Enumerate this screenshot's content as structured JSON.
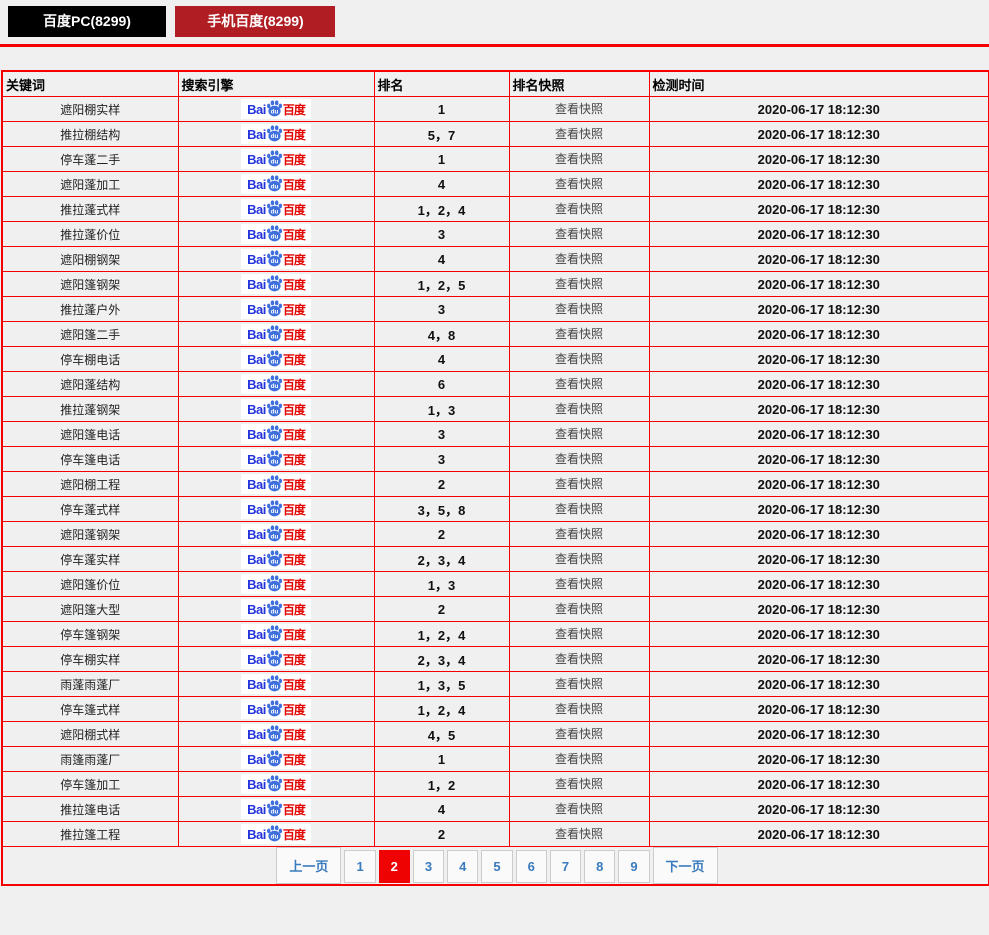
{
  "tabs": [
    {
      "id": "baidu-pc",
      "label": "百度PC(8299)"
    },
    {
      "id": "mobile-baidu",
      "label": "手机百度(8299)"
    }
  ],
  "table": {
    "headers": [
      "关键词",
      "搜索引擎",
      "排名",
      "排名快照",
      "检测时间"
    ],
    "snapshot_label": "查看快照",
    "search_engine_logo": {
      "bai": "Bai",
      "du": "du",
      "cn": "百度"
    },
    "rows": [
      {
        "keyword": "遮阳棚实样",
        "rank": "1",
        "time": "2020-06-17 18:12:30"
      },
      {
        "keyword": "推拉棚结构",
        "rank": "5，7",
        "time": "2020-06-17 18:12:30"
      },
      {
        "keyword": "停车蓬二手",
        "rank": "1",
        "time": "2020-06-17 18:12:30"
      },
      {
        "keyword": "遮阳蓬加工",
        "rank": "4",
        "time": "2020-06-17 18:12:30"
      },
      {
        "keyword": "推拉蓬式样",
        "rank": "1，2，4",
        "time": "2020-06-17 18:12:30"
      },
      {
        "keyword": "推拉蓬价位",
        "rank": "3",
        "time": "2020-06-17 18:12:30"
      },
      {
        "keyword": "遮阳棚钢架",
        "rank": "4",
        "time": "2020-06-17 18:12:30"
      },
      {
        "keyword": "遮阳篷钢架",
        "rank": "1，2，5",
        "time": "2020-06-17 18:12:30"
      },
      {
        "keyword": "推拉蓬户外",
        "rank": "3",
        "time": "2020-06-17 18:12:30"
      },
      {
        "keyword": "遮阳篷二手",
        "rank": "4，8",
        "time": "2020-06-17 18:12:30"
      },
      {
        "keyword": "停车棚电话",
        "rank": "4",
        "time": "2020-06-17 18:12:30"
      },
      {
        "keyword": "遮阳蓬结构",
        "rank": "6",
        "time": "2020-06-17 18:12:30"
      },
      {
        "keyword": "推拉蓬钢架",
        "rank": "1，3",
        "time": "2020-06-17 18:12:30"
      },
      {
        "keyword": "遮阳篷电话",
        "rank": "3",
        "time": "2020-06-17 18:12:30"
      },
      {
        "keyword": "停车篷电话",
        "rank": "3",
        "time": "2020-06-17 18:12:30"
      },
      {
        "keyword": "遮阳棚工程",
        "rank": "2",
        "time": "2020-06-17 18:12:30"
      },
      {
        "keyword": "停车蓬式样",
        "rank": "3，5，8",
        "time": "2020-06-17 18:12:30"
      },
      {
        "keyword": "遮阳蓬钢架",
        "rank": "2",
        "time": "2020-06-17 18:12:30"
      },
      {
        "keyword": "停车蓬实样",
        "rank": "2，3，4",
        "time": "2020-06-17 18:12:30"
      },
      {
        "keyword": "遮阳篷价位",
        "rank": "1，3",
        "time": "2020-06-17 18:12:30"
      },
      {
        "keyword": "遮阳篷大型",
        "rank": "2",
        "time": "2020-06-17 18:12:30"
      },
      {
        "keyword": "停车篷钢架",
        "rank": "1，2，4",
        "time": "2020-06-17 18:12:30"
      },
      {
        "keyword": "停车棚实样",
        "rank": "2，3，4",
        "time": "2020-06-17 18:12:30"
      },
      {
        "keyword": "雨蓬雨蓬厂",
        "rank": "1，3，5",
        "time": "2020-06-17 18:12:30"
      },
      {
        "keyword": "停车篷式样",
        "rank": "1，2，4",
        "time": "2020-06-17 18:12:30"
      },
      {
        "keyword": "遮阳棚式样",
        "rank": "4，5",
        "time": "2020-06-17 18:12:30"
      },
      {
        "keyword": "雨篷雨蓬厂",
        "rank": "1",
        "time": "2020-06-17 18:12:30"
      },
      {
        "keyword": "停车篷加工",
        "rank": "1，2",
        "time": "2020-06-17 18:12:30"
      },
      {
        "keyword": "推拉篷电话",
        "rank": "4",
        "time": "2020-06-17 18:12:30"
      },
      {
        "keyword": "推拉篷工程",
        "rank": "2",
        "time": "2020-06-17 18:12:30"
      }
    ]
  },
  "pagination": {
    "prev": "上一页",
    "next": "下一页",
    "pages": [
      "1",
      "2",
      "3",
      "4",
      "5",
      "6",
      "7",
      "8",
      "9"
    ],
    "active": "2"
  },
  "colors": {
    "border_red": "#f50000",
    "tab_pc_bg": "#000000",
    "tab_mobile_bg": "#b01e23",
    "active_page_bg": "#ee0202",
    "page_link": "#3a7bbd",
    "logo_blue": "#2334dc",
    "logo_paw_blue": "#3f6fdd",
    "logo_red": "#e10601",
    "page_bg": "#f0f0f0"
  }
}
